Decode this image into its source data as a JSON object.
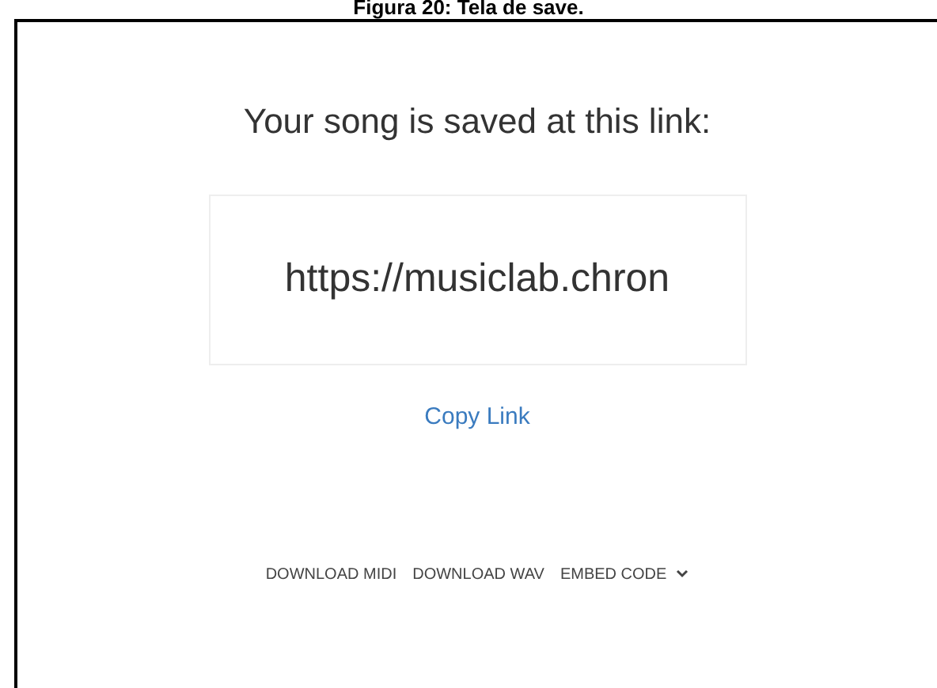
{
  "caption": "Figura 20: Tela de save.",
  "heading": "Your song is saved at this link:",
  "link_field": {
    "value": "https://musiclab.chron"
  },
  "copy_link": "Copy Link",
  "actions": [
    {
      "label": "DOWNLOAD MIDI",
      "kind": "plain"
    },
    {
      "label": "DOWNLOAD WAV",
      "kind": "plain"
    },
    {
      "label": "EMBED CODE",
      "kind": "dropdown"
    }
  ]
}
